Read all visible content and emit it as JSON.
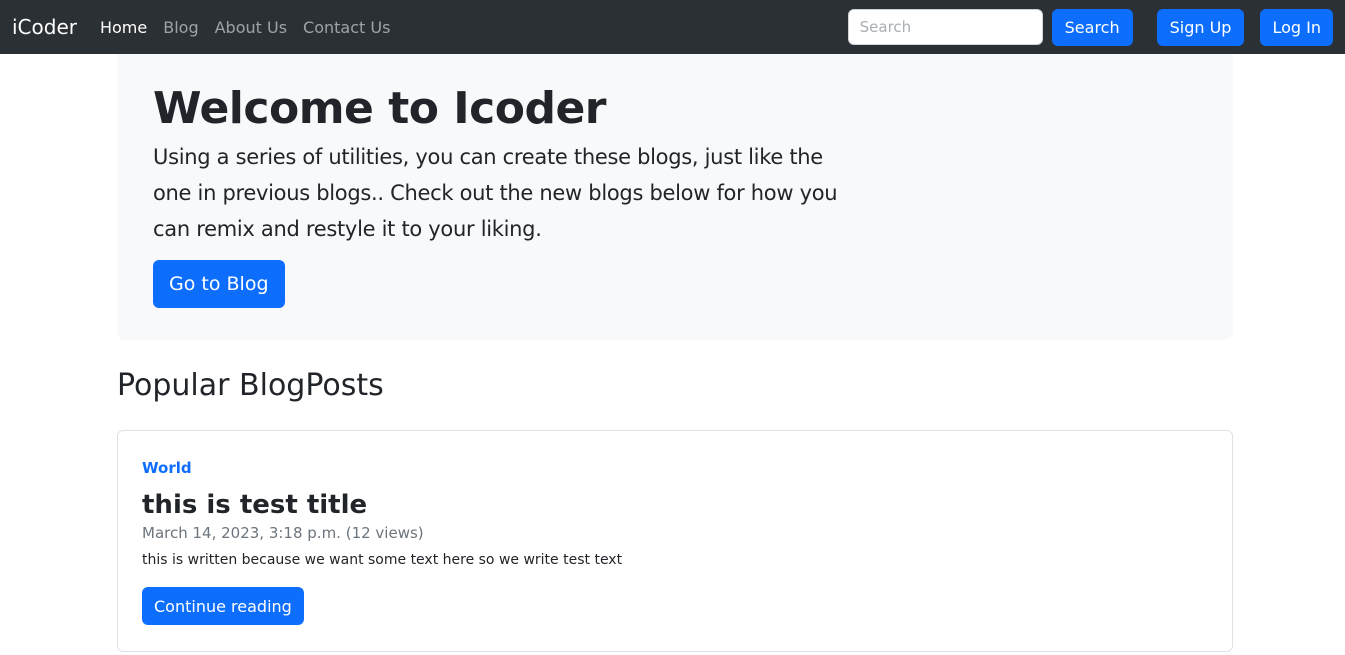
{
  "navbar": {
    "brand": "iCoder",
    "links": [
      {
        "label": "Home",
        "active": true
      },
      {
        "label": "Blog",
        "active": false
      },
      {
        "label": "About Us",
        "active": false
      },
      {
        "label": "Contact Us",
        "active": false
      }
    ],
    "search_placeholder": "Search",
    "search_value": "",
    "search_button": "Search",
    "signup_button": "Sign Up",
    "login_button": "Log In"
  },
  "hero": {
    "title": "Welcome to Icoder",
    "text": "Using a series of utilities, you can create these blogs, just like the one in previous blogs.. Check out the new blogs below for how you can remix and restyle it to your liking.",
    "button": "Go to Blog"
  },
  "popular": {
    "title": "Popular BlogPosts",
    "posts": [
      {
        "category": "World",
        "title": "this is test title",
        "meta": "March 14, 2023, 3:18 p.m. (12 views)",
        "excerpt": "this is written because we want some text here so we write test text",
        "button": "Continue reading"
      }
    ]
  },
  "colors": {
    "navbar_bg": "#2b3035",
    "primary": "#0d6efd",
    "hero_bg": "#f8f9fa",
    "text": "#212529",
    "muted": "#6c757d"
  }
}
